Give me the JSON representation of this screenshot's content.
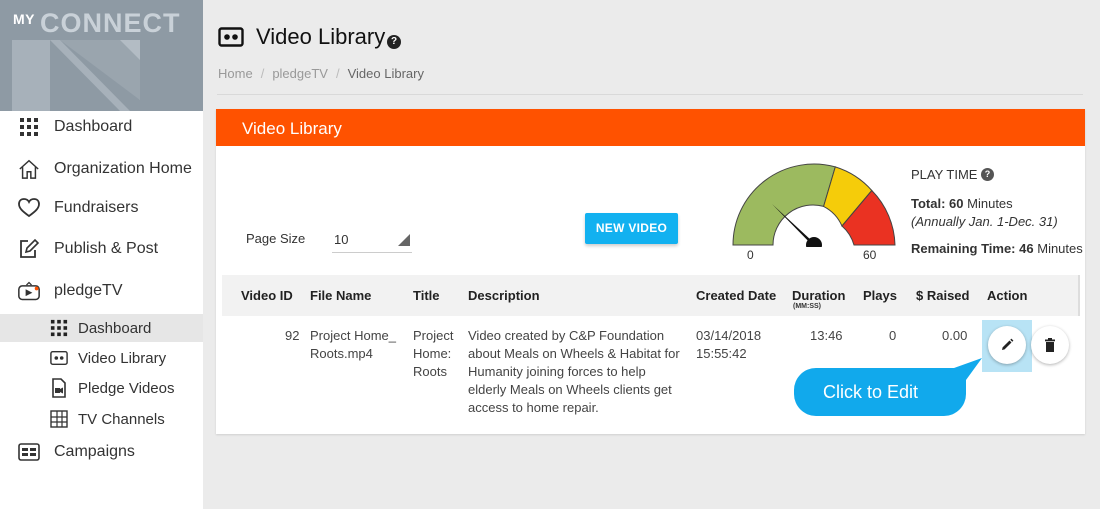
{
  "logo": {
    "my": "MY",
    "connect": "CONNECT"
  },
  "sidebar": {
    "items": [
      {
        "label": "Dashboard"
      },
      {
        "label": "Organization Home"
      },
      {
        "label": "Fundraisers"
      },
      {
        "label": "Publish & Post"
      },
      {
        "label": "pledgeTV"
      },
      {
        "label": "Campaigns"
      }
    ],
    "subitems": [
      {
        "label": "Dashboard"
      },
      {
        "label": "Video Library"
      },
      {
        "label": "Pledge Videos"
      },
      {
        "label": "TV Channels"
      }
    ]
  },
  "header": {
    "title": "Video Library",
    "help": "?",
    "breadcrumb": [
      "Home",
      "pledgeTV",
      "Video Library"
    ],
    "separator": "/"
  },
  "card": {
    "title": "Video Library",
    "page_size_label": "Page Size",
    "page_size_value": "10",
    "new_video_label": "NEW VIDEO",
    "gauge": {
      "min": "0",
      "max": "60",
      "value": 20
    },
    "playtime": {
      "title": "PLAY TIME",
      "help": "?",
      "total_label": "Total:",
      "total_value": "60",
      "total_unit": "Minutes",
      "period": "(Annually Jan. 1-Dec. 31)",
      "remaining_label": "Remaining Time:",
      "remaining_value": "46",
      "remaining_unit": "Minutes"
    }
  },
  "table": {
    "columns": {
      "video_id": "Video ID",
      "file_name": "File Name",
      "title": "Title",
      "description": "Description",
      "created_date": "Created Date",
      "duration": "Duration",
      "duration_unit": "(MM:SS)",
      "plays": "Plays",
      "raised": "$ Raised",
      "action": "Action"
    },
    "rows": [
      {
        "video_id": "92",
        "file_name": [
          "Project Home_",
          "Roots.mp4"
        ],
        "title": [
          "Project",
          "Home:",
          "Roots"
        ],
        "description": [
          "Video created by C&P Foundation",
          "about Meals on Wheels & Habitat for",
          "Humanity joining forces to help",
          "elderly Meals on Wheels clients get",
          "access to home repair."
        ],
        "created_date": "03/14/2018",
        "created_time": "15:55:42",
        "duration": "13:46",
        "plays": "0",
        "raised": "0.00"
      }
    ]
  },
  "callout": {
    "text": "Click to Edit"
  },
  "colors": {
    "accent": "#ff5200",
    "button": "#12b1f0",
    "callout": "#11a9ec",
    "gauge_green": "#9cba5f",
    "gauge_yellow": "#f5cc0a",
    "gauge_red": "#ea3222"
  }
}
